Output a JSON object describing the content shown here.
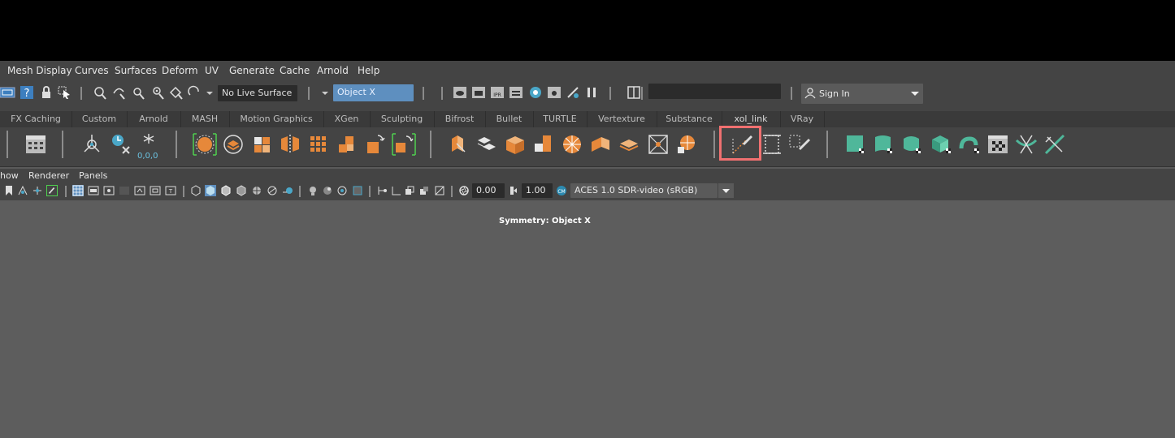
{
  "main_menu": [
    "Mesh Display",
    "Curves",
    "Surfaces",
    "Deform",
    "UV",
    "Generate",
    "Cache",
    "Arnold",
    "Help"
  ],
  "status_line": {
    "live_surface": "No Live Surface",
    "symmetry": "Object X",
    "sign_in": "Sign In"
  },
  "shelf_tabs": [
    "FX Caching",
    "Custom",
    "Arnold",
    "MASH",
    "Motion Graphics",
    "XGen",
    "Sculpting",
    "Bifrost",
    "Bullet",
    "TURTLE",
    "Vertexture",
    "Substance",
    "xol_link",
    "VRay"
  ],
  "shelf": {
    "zero_label": "0,0,0",
    "highlight_color": "#ff6b6b"
  },
  "panel_menu": [
    "how",
    "Renderer",
    "Panels"
  ],
  "panel_toolbar": {
    "exposure": "0.00",
    "gamma": "1.00",
    "color_space": "ACES 1.0 SDR-video (sRGB)"
  },
  "viewport": {
    "symmetry_label": "Symmetry: Object X"
  },
  "colors": {
    "accent_blue": "#5e8fbf",
    "shelf_orange": "#e6883a",
    "shelf_green": "#4fb79a"
  }
}
